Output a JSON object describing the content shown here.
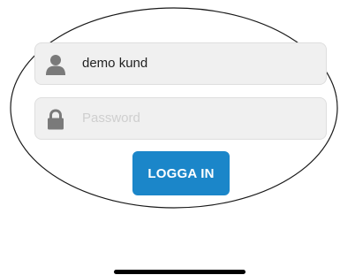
{
  "login_form": {
    "username": {
      "value": "demo kund",
      "icon": "user-icon"
    },
    "password": {
      "placeholder": "Password",
      "value": "",
      "icon": "lock-icon"
    },
    "login_button_label": "LOGGA IN"
  },
  "colors": {
    "accent": "#1b86c9",
    "field_background": "#f0f0f0",
    "icon": "#7a7a7a"
  }
}
